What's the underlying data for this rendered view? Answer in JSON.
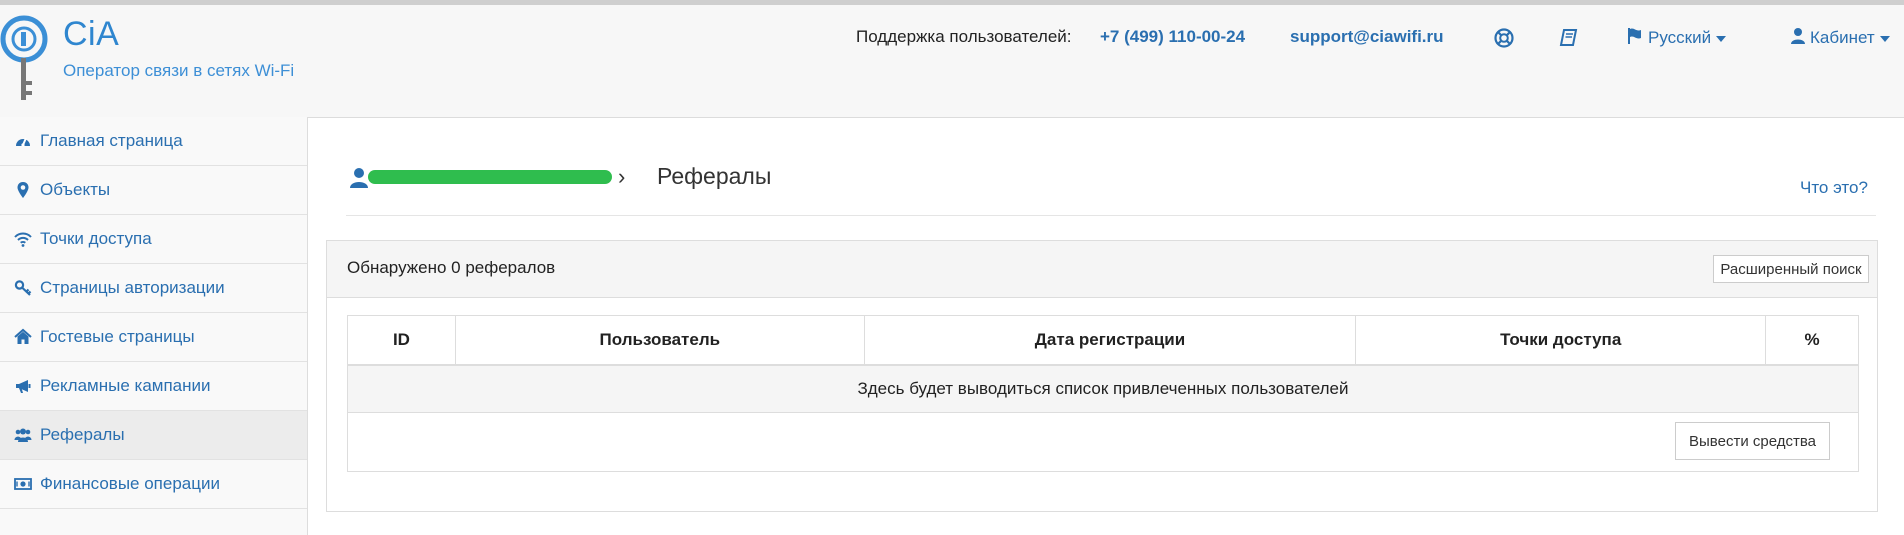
{
  "header": {
    "logo_text": "CiA",
    "tagline": "Оператор связи в сетях Wi-Fi",
    "support_label": "Поддержка пользователей:",
    "support_phone": "+7 (499) 110-00-24",
    "support_email": "support@ciawifi.ru",
    "icons": [
      "lifebuoy-icon",
      "book-icon"
    ],
    "language": "Русский",
    "cabinet": "Кабинет"
  },
  "sidebar": {
    "items": [
      {
        "label": "Главная страница",
        "icon": "dashboard-icon",
        "active": false
      },
      {
        "label": "Объекты",
        "icon": "map-marker-icon",
        "active": false
      },
      {
        "label": "Точки доступа",
        "icon": "wifi-icon",
        "active": false
      },
      {
        "label": "Страницы авторизации",
        "icon": "key-icon",
        "active": false
      },
      {
        "label": "Гостевые страницы",
        "icon": "home-icon",
        "active": false
      },
      {
        "label": "Рекламные кампании",
        "icon": "bullhorn-icon",
        "active": false
      },
      {
        "label": "Рефералы",
        "icon": "users-icon",
        "active": true
      },
      {
        "label": "Финансовые операции",
        "icon": "money-icon",
        "active": false
      }
    ]
  },
  "breadcrumb": {
    "separator": "›",
    "current": "Рефералы"
  },
  "help_link": "Что это?",
  "panel": {
    "found_text": "Обнаружено 0 рефералов",
    "advanced_search": "Расширенный поиск"
  },
  "table": {
    "columns": [
      "ID",
      "Пользователь",
      "Дата регистрации",
      "Точки доступа",
      "%"
    ],
    "empty_message": "Здесь будет выводиться список привлеченных пользователей",
    "withdraw_button": "Вывести средства"
  },
  "colors": {
    "link": "#2a6fb0",
    "logo": "#2f86cf",
    "redaction": "#2fbd4e",
    "active_nav": "#ececec"
  }
}
